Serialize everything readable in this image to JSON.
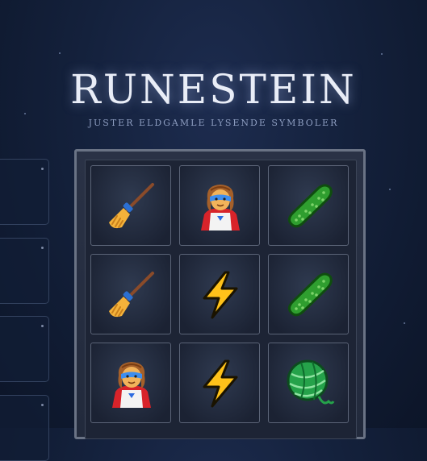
{
  "header": {
    "title": "RUNESTEIN",
    "subtitle": "JUSTER ELDGAMLE LYSENDE SYMBOLER"
  },
  "grid": [
    [
      "broom-icon",
      "superhero-icon",
      "cucumber-icon"
    ],
    [
      "broom-icon",
      "lightning-icon",
      "cucumber-icon"
    ],
    [
      "superhero-icon",
      "lightning-icon",
      "yarn-icon"
    ]
  ]
}
